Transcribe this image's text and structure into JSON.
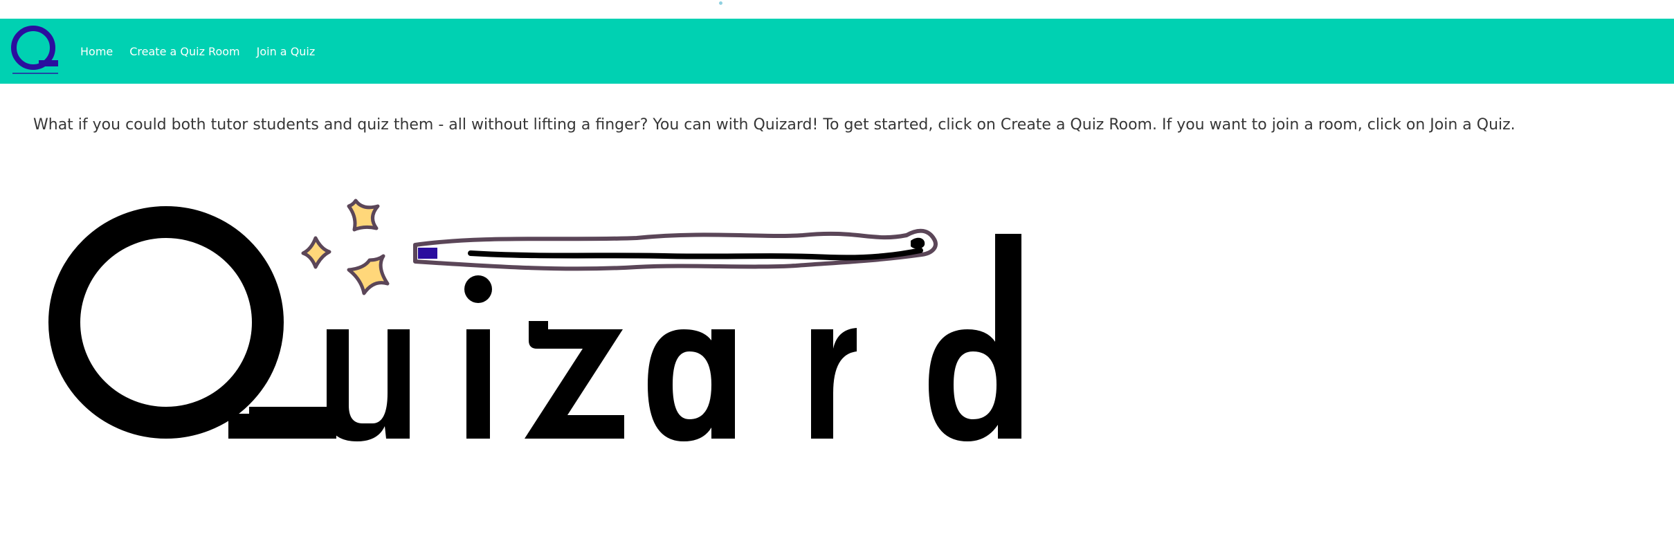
{
  "navbar": {
    "background": "#00d1b2",
    "logo_letter": "Q",
    "logo_color": "#2b0e9e",
    "links": [
      {
        "label": "Home"
      },
      {
        "label": "Create a Quiz Room"
      },
      {
        "label": "Join a Quiz"
      }
    ]
  },
  "main": {
    "intro_text": "What if you could both tutor students and quiz them - all without lifting a finger? You can with Quizard! To get started, click on Create a Quiz Room. If you want to join a room, click on Join a Quiz.",
    "hero": {
      "wordmark": "Quizard",
      "icons": [
        "sparkles-icon",
        "magic-wand-icon"
      ]
    }
  }
}
